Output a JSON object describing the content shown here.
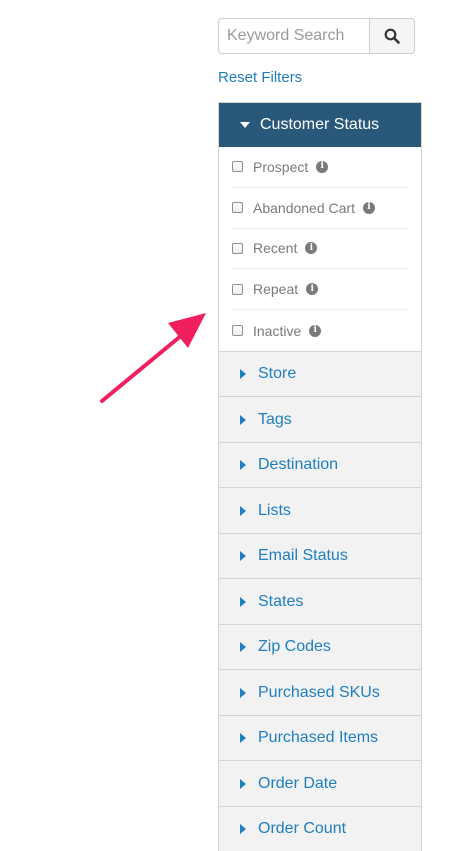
{
  "search": {
    "placeholder": "Keyword Search",
    "value": "",
    "button_icon": "search-icon"
  },
  "reset_filters": "Reset Filters",
  "open_section": {
    "title": "Customer Status",
    "options": [
      {
        "label": "Prospect",
        "checked": false,
        "icon": "info-icon"
      },
      {
        "label": "Abandoned Cart",
        "checked": false,
        "icon": "info-icon"
      },
      {
        "label": "Recent",
        "checked": false,
        "icon": "info-icon"
      },
      {
        "label": "Repeat",
        "checked": false,
        "icon": "info-icon"
      },
      {
        "label": "Inactive",
        "checked": false,
        "icon": "info-icon"
      }
    ]
  },
  "collapsed_sections": [
    "Store",
    "Tags",
    "Destination",
    "Lists",
    "Email Status",
    "States",
    "Zip Codes",
    "Purchased SKUs",
    "Purchased Items",
    "Order Date",
    "Order Count"
  ],
  "colors": {
    "header_open": "#2a587a",
    "link": "#1f7fbd",
    "collapsed_bg": "#f2f2f2",
    "annotation_arrow": "#f0205f"
  }
}
